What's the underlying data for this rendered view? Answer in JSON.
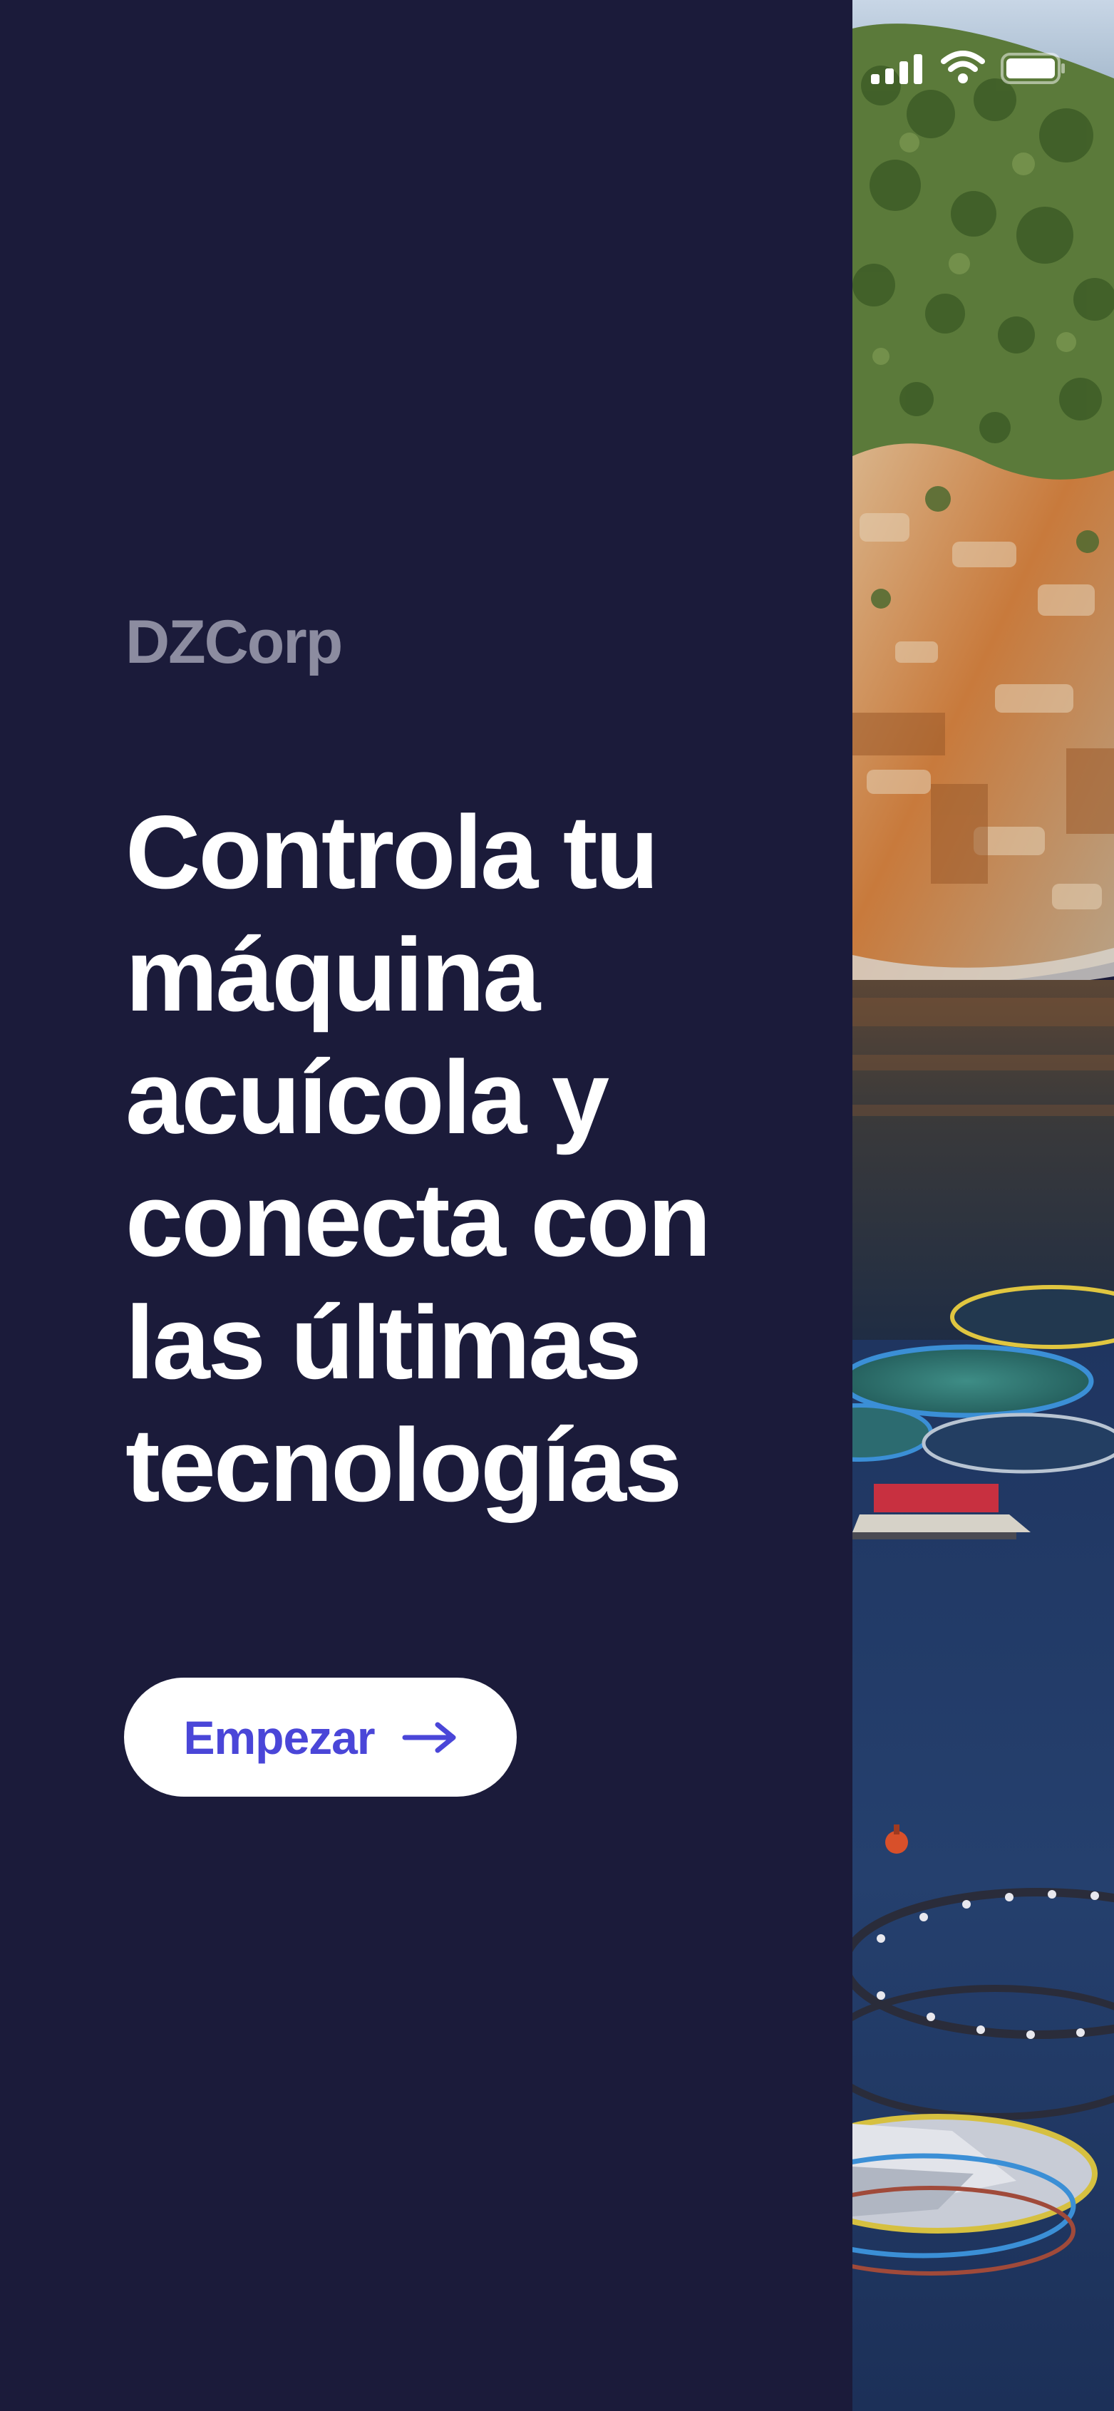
{
  "brand": {
    "name": "DZCorp"
  },
  "hero": {
    "headline": "Controla tu máquina acuícola y conecta con las últimas tecnologías"
  },
  "cta": {
    "label": "Empezar",
    "icon": "arrow-right-icon",
    "color": "#4a46d8"
  },
  "status_bar": {
    "icons": [
      "signal-icon",
      "wifi-icon",
      "battery-icon"
    ]
  },
  "colors": {
    "background": "#1b1b3a",
    "brand_text": "#8c8ca0",
    "headline_text": "#ffffff",
    "button_bg": "#ffffff"
  },
  "image": {
    "subject": "aquaculture-fish-farm-photo"
  }
}
